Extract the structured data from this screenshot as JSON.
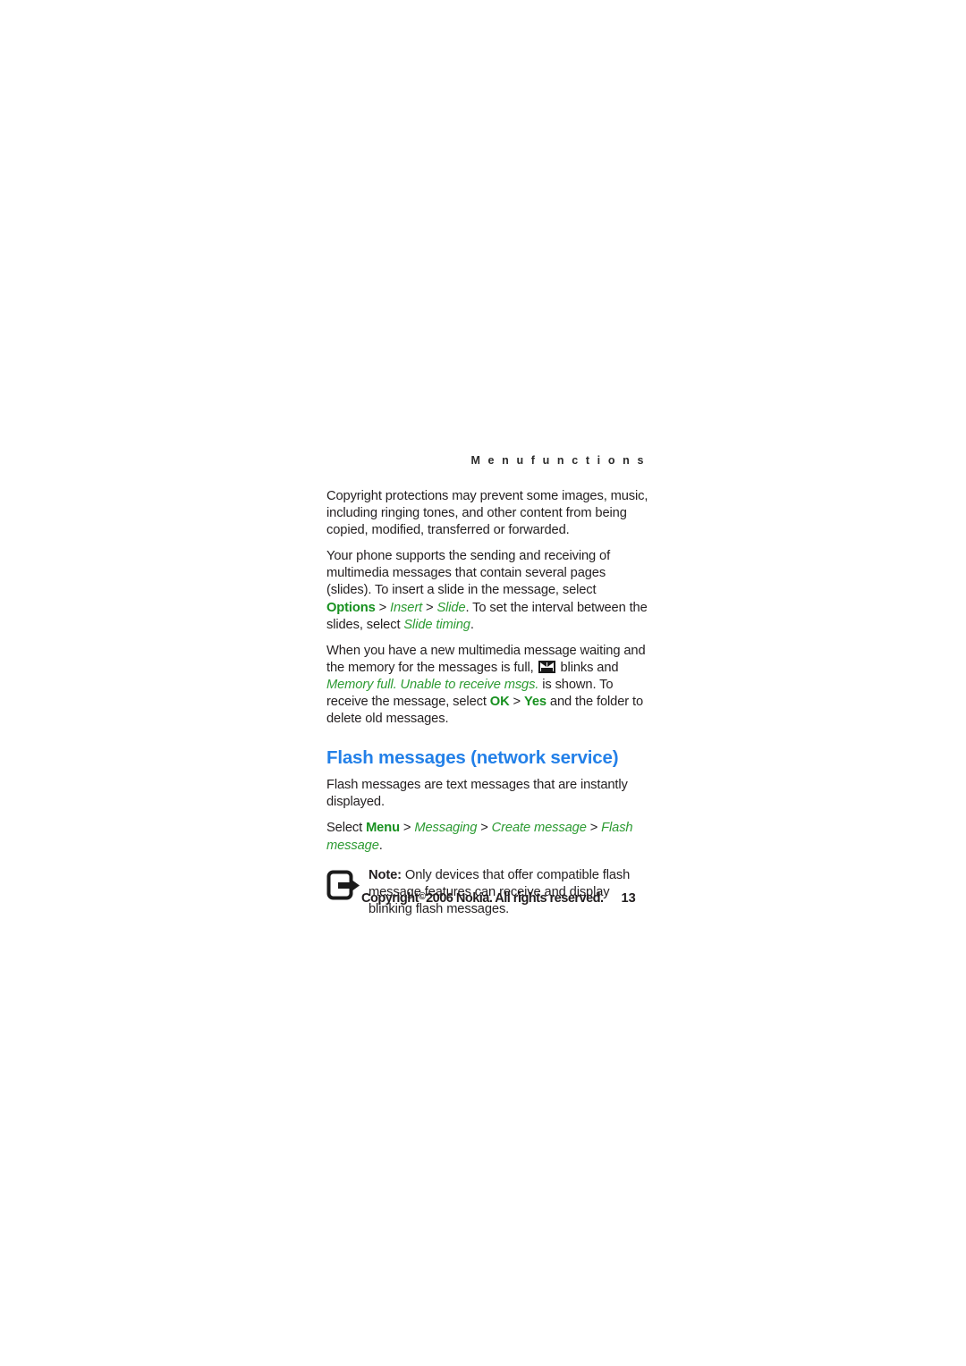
{
  "header": {
    "running_title": "M e n u   f u n c t i o n s"
  },
  "body": {
    "paragraph_1": "Copyright protections may prevent some images, music, including ringing tones, and other content from being copied, modified, transferred or forwarded.",
    "paragraph_2": {
      "seg_1": "Your phone supports the sending and receiving of multimedia messages that contain several pages (slides). To insert a slide in the message, select ",
      "options_label": "Options",
      "sep_1": " > ",
      "insert_label": "Insert",
      "sep_2": " > ",
      "slide_label": "Slide",
      "seg_2": ". To set the interval between the slides, select ",
      "slide_timing_label": "Slide timing",
      "seg_3": "."
    },
    "paragraph_3": {
      "seg_1": "When you have a new multimedia message waiting and the memory for the messages is full, ",
      "icon": "message-waiting-icon",
      "seg_2": " blinks and ",
      "memory_full_label": "Memory full. Unable to receive msgs.",
      "seg_3": " is shown. To receive the message, select ",
      "ok_label": "OK",
      "sep_1": " > ",
      "yes_label": "Yes",
      "seg_4": " and the folder to delete old messages."
    }
  },
  "section": {
    "heading": "Flash messages (network service)",
    "intro": "Flash messages are text messages that are instantly displayed.",
    "path_line": {
      "select_word": "Select ",
      "menu_label": "Menu",
      "sep_1": " > ",
      "messaging_label": "Messaging",
      "sep_2": " > ",
      "create_message_label": "Create message",
      "sep_3": " > ",
      "flash_message_label": "Flash message",
      "end": "."
    },
    "note": {
      "icon": "note-arrow-icon",
      "lead": "Note:",
      "text": " Only devices that offer compatible flash message features can receive and display blinking flash messages."
    }
  },
  "footer": {
    "copyright_prefix": "Copyright",
    "copyright_mark": "©",
    "copyright_rest": "2006 Nokia. All rights reserved.",
    "page_number": "13"
  },
  "colors": {
    "heading_blue": "#2380e8",
    "ui_green": "#2d9b33",
    "ui_green_bold": "#17901f",
    "body_black": "#231f20"
  }
}
